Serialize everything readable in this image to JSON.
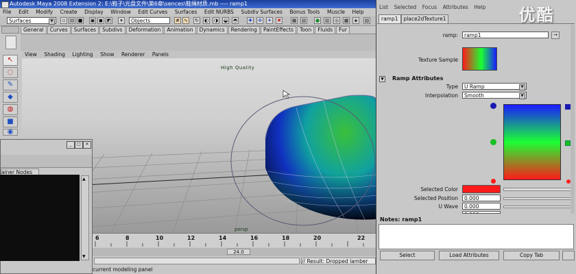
{
  "window": {
    "title": "Autodesk Maya 2008 Extension 2: E:\\鞋子\\光盘文件\\第6章\\sences\\鞋绳材质.mb  ----  ramp1"
  },
  "menubar": [
    "File",
    "Edit",
    "Modify",
    "Create",
    "Display",
    "Window",
    "Edit Curves",
    "Surfaces",
    "Edit NURBS",
    "Subdiv Surfaces",
    "Bonus Tools",
    "Muscle",
    "Help"
  ],
  "statusline": {
    "mode_value": "Surfaces",
    "selection_field": "Objects"
  },
  "shelf_tabs": [
    "General",
    "Curves",
    "Surfaces",
    "Subdivs",
    "Deformation",
    "Animation",
    "Dynamics",
    "Rendering",
    "PaintEffects",
    "Toon",
    "Fluids",
    "Fur"
  ],
  "viewport": {
    "menu": [
      "View",
      "Shading",
      "Lighting",
      "Show",
      "Renderer",
      "Panels"
    ],
    "hud_quality": "High Quality",
    "camera_label": "persp"
  },
  "float_window": {
    "tab_label": "ainer Nodes"
  },
  "timeslider": {
    "ticks": [
      "6",
      "8",
      "10",
      "12",
      "14",
      "16",
      "18",
      "20",
      "22"
    ],
    "range_value": "24.0"
  },
  "commandline": {
    "result": "// Result: Dropped lamber"
  },
  "helpline": {
    "text": "current modeling panel"
  },
  "attribute_editor": {
    "menu": [
      "List",
      "Selected",
      "Focus",
      "Attributes",
      "Help"
    ],
    "tabs": [
      "ramp1",
      "place2dTexture1"
    ],
    "ramp_label": "ramp:",
    "ramp_name": "ramp1",
    "texture_sample_label": "Texture Sample",
    "section_title": "Ramp Attributes",
    "type_label": "Type",
    "type_value": "U Ramp",
    "interpolation_label": "Interpolation",
    "interpolation_value": "Smooth",
    "selected_color_label": "Selected Color",
    "selected_position_label": "Selected Position",
    "selected_position_value": "0.000",
    "u_wave_label": "U Wave",
    "u_wave_value": "0.000",
    "v_wave_value": "0.000",
    "notes_label": "Notes:  ramp1",
    "buttons": [
      "Select",
      "Load Attributes",
      "Copy Tab"
    ]
  },
  "watermark": "优酷",
  "colors": {
    "title_blue": "#1b3f9c",
    "ramp_red": "#ff1a1a",
    "ramp_green": "#1aff33",
    "ramp_blue": "#1a1aff",
    "selected_color": "#ff1a1a"
  }
}
